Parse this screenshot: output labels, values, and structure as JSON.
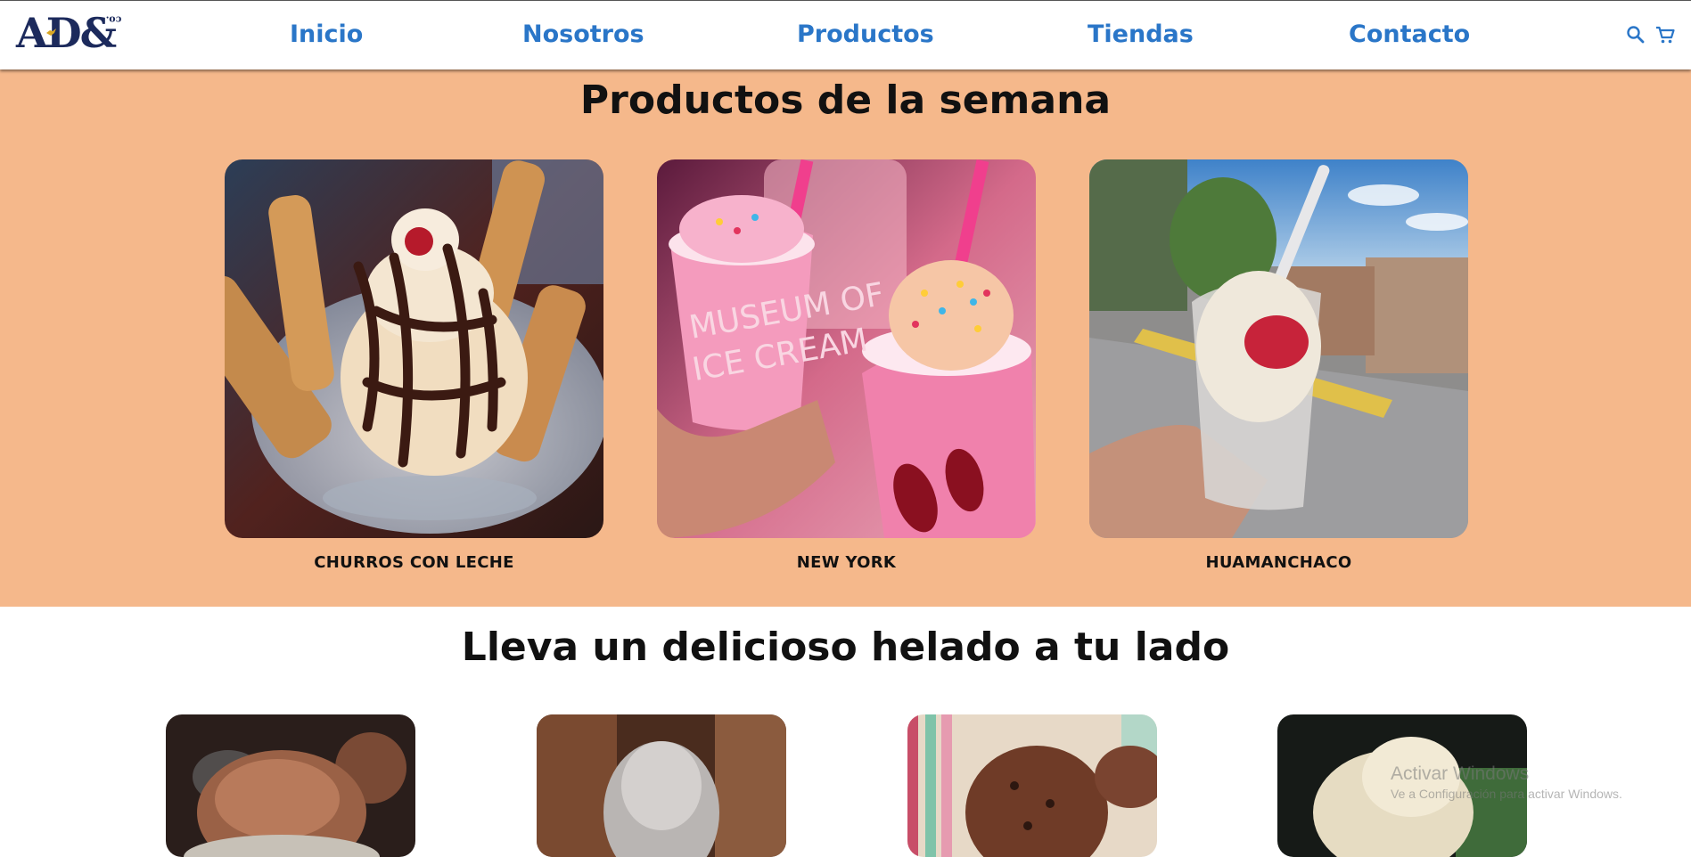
{
  "brand": {
    "logo_text": "AD&",
    "logo_suffix": "co."
  },
  "nav": {
    "items": [
      {
        "label": "Inicio"
      },
      {
        "label": "Nosotros"
      },
      {
        "label": "Productos"
      },
      {
        "label": "Tiendas"
      },
      {
        "label": "Contacto"
      }
    ],
    "icons": [
      "search-icon",
      "cart-icon"
    ],
    "link_color": "#2a76c8"
  },
  "weekly": {
    "title": "Productos de la semana",
    "background": "#f5b88b",
    "products": [
      {
        "name": "CHURROS CON LECHE"
      },
      {
        "name": "NEW YORK"
      },
      {
        "name": "HUAMANCHACO"
      }
    ]
  },
  "carry": {
    "title": "Lleva un delicioso helado a tu lado"
  },
  "watermark": {
    "title": "Activar Windows",
    "subtitle": "Ve a Configuración para activar Windows."
  }
}
